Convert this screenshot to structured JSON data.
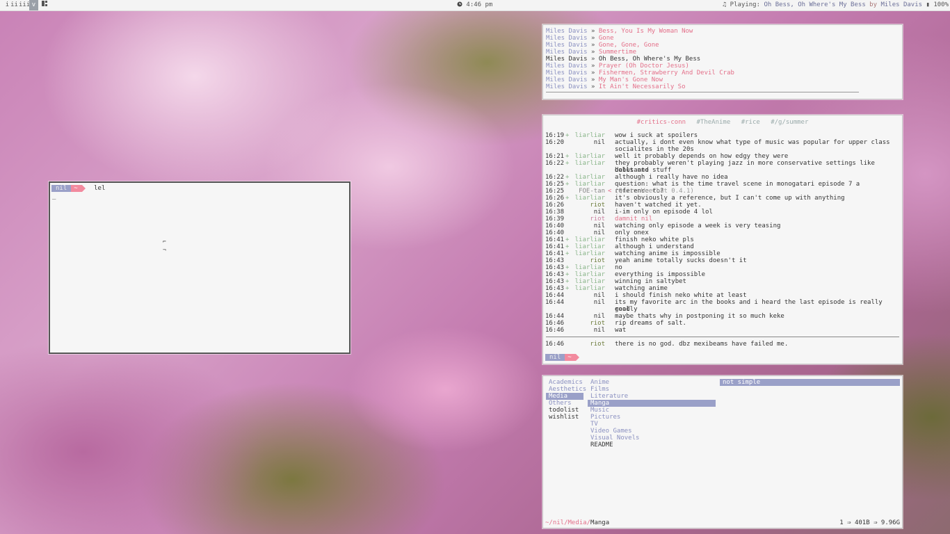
{
  "topbar": {
    "workspaces": [
      "i",
      "ii",
      "iii",
      "v"
    ],
    "active_workspace": "v",
    "layout_icon": "tile-layout-icon",
    "clock": "4:46 pm",
    "clock_icon": "clock-icon",
    "music_icon": "music-note-icon",
    "now_playing_label": "Playing:",
    "now_playing_track": "Oh Bess, Oh Where's My Bess",
    "now_playing_by": "by",
    "now_playing_artist": "Miles Davis",
    "battery_icon": "battery-icon",
    "battery": "100%"
  },
  "playlist": {
    "items": [
      {
        "artist": "Miles Davis",
        "title": "Bess, You Is My Woman Now"
      },
      {
        "artist": "Miles Davis",
        "title": "Gone"
      },
      {
        "artist": "Miles Davis",
        "title": "Gone, Gone, Gone"
      },
      {
        "artist": "Miles Davis",
        "title": "Summertime"
      },
      {
        "artist": "Miles Davis",
        "title": "Oh Bess, Oh Where's My Bess"
      },
      {
        "artist": "Miles Davis",
        "title": "Prayer (Oh Doctor Jesus)"
      },
      {
        "artist": "Miles Davis",
        "title": "Fishermen, Strawberry And Devil Crab"
      },
      {
        "artist": "Miles Davis",
        "title": "My Man's Gone Now"
      },
      {
        "artist": "Miles Davis",
        "title": "It Ain't Necessarily So"
      }
    ],
    "separator": "»",
    "current_index": 4
  },
  "irc": {
    "channels": [
      "#critics-conn",
      "#TheAnime",
      "#rice",
      "#/g/summer"
    ],
    "active_channel": "#critics-conn",
    "messages": [
      {
        "time": "16:19",
        "mode": "+",
        "nick": "liarliar",
        "text": "wow i suck at spoilers"
      },
      {
        "time": "16:20",
        "mode": "",
        "nick": "nil",
        "text": "actually, i dont even know what type of music was popular for upper class"
      },
      {
        "time": "",
        "mode": "",
        "nick": "",
        "text": "socialites in the 20s"
      },
      {
        "time": "16:21",
        "mode": "+",
        "nick": "liarliar",
        "text": "well it probably depends on how edgy they were"
      },
      {
        "time": "16:22",
        "mode": "+",
        "nick": "liarliar",
        "text": "they probably weren't playing jazz in more conservative settings like debutante"
      },
      {
        "time": "",
        "mode": "",
        "nick": "",
        "text": "balls and stuff"
      },
      {
        "time": "16:22",
        "mode": "+",
        "nick": "liarliar",
        "text": "although i really have no idea"
      },
      {
        "time": "16:25",
        "mode": "+",
        "nick": "liarliar",
        "text": "question: what is the time travel scene in monogatari episode 7 a reference to?"
      },
      {
        "time": "16:25",
        "mode": "",
        "nick": "FOE-tan",
        "text": "(Quit: WeeChat 0.4.1)",
        "kind": "quit",
        "arrow": "<"
      },
      {
        "time": "16:26",
        "mode": "+",
        "nick": "liarliar",
        "text": "it's obviously a reference, but I can't come up with anything"
      },
      {
        "time": "16:26",
        "mode": "",
        "nick": "riot",
        "text": "haven't watched it yet."
      },
      {
        "time": "16:38",
        "mode": "",
        "nick": "nil",
        "text": "i-im only on episode 4 lol"
      },
      {
        "time": "16:39",
        "mode": "",
        "nick": "riot",
        "text": "damnit nil",
        "kind": "hl"
      },
      {
        "time": "16:40",
        "mode": "",
        "nick": "nil",
        "text": "watching only episode a week is very teasing"
      },
      {
        "time": "16:40",
        "mode": "",
        "nick": "nil",
        "text": "only onex"
      },
      {
        "time": "16:41",
        "mode": "+",
        "nick": "liarliar",
        "text": "finish neko white pls"
      },
      {
        "time": "16:41",
        "mode": "+",
        "nick": "liarliar",
        "text": "although i understand"
      },
      {
        "time": "16:41",
        "mode": "+",
        "nick": "liarliar",
        "text": "watching anime is impossible"
      },
      {
        "time": "16:43",
        "mode": "",
        "nick": "riot",
        "text": "yeah anime totally sucks doesn't it"
      },
      {
        "time": "16:43",
        "mode": "+",
        "nick": "liarliar",
        "text": "no"
      },
      {
        "time": "16:43",
        "mode": "+",
        "nick": "liarliar",
        "text": "everything is impossible"
      },
      {
        "time": "16:43",
        "mode": "+",
        "nick": "liarliar",
        "text": "winning in saltybet"
      },
      {
        "time": "16:43",
        "mode": "+",
        "nick": "liarliar",
        "text": "watching anime"
      },
      {
        "time": "16:44",
        "mode": "",
        "nick": "nil",
        "text": "i should finish neko white at least"
      },
      {
        "time": "16:44",
        "mode": "",
        "nick": "nil",
        "text": "its my favorite arc in the books and i heard the last episode is really really"
      },
      {
        "time": "",
        "mode": "",
        "nick": "",
        "text": "good"
      },
      {
        "time": "16:44",
        "mode": "",
        "nick": "nil",
        "text": "maybe thats why in postponing it so much keke"
      },
      {
        "time": "16:46",
        "mode": "",
        "nick": "riot",
        "text": "rip dreams of salt."
      },
      {
        "time": "16:46",
        "mode": "",
        "nick": "nil",
        "text": "wat"
      }
    ],
    "last_message": {
      "time": "16:46",
      "nick": "riot",
      "text": "there is no god. dbz mexibeams have failed me."
    },
    "prompt_user": "nil",
    "prompt_dir": "~"
  },
  "terminal": {
    "prompt_user": "nil",
    "prompt_dir": "~",
    "command": "lel",
    "cursor": "_",
    "glyph1": "⌐",
    "glyph2": "¬"
  },
  "ranger": {
    "col1": [
      "Academics",
      "Aesthetics",
      "Media",
      "Others",
      "todolist",
      "wishlist"
    ],
    "col1_selected": "Media",
    "col1_files": [
      "todolist",
      "wishlist"
    ],
    "col2": [
      "Anime",
      "Films",
      "Literature",
      "Manga",
      "Music",
      "Pictures",
      "TV",
      "Video Games",
      "Visual Novels",
      "README"
    ],
    "col2_selected": "Manga",
    "col2_files": [
      "README"
    ],
    "col3": [
      "not simple"
    ],
    "status_path_prefix": "~/nil/Media/",
    "status_path_current": "Manga",
    "status_right": "1  ⇒  401B  ⇒  9.96G"
  },
  "colors": {
    "accent_pink": "#e36f89",
    "accent_lavender": "#9aa0c8",
    "nick_green": "#8ab58a"
  }
}
